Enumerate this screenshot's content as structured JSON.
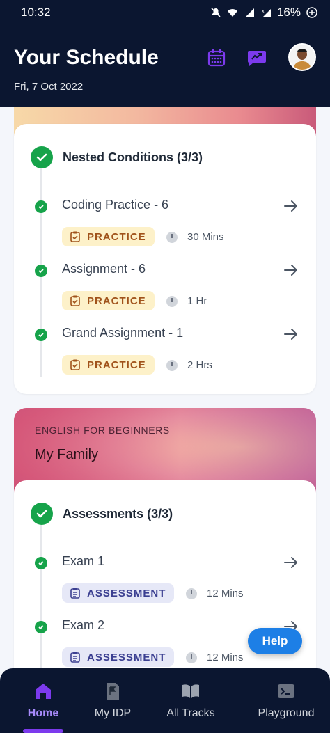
{
  "status_bar": {
    "time": "10:32",
    "battery": "16%",
    "icons": [
      "mute-icon",
      "wifi-icon",
      "signal-icon",
      "signal-x-icon",
      "battery-icon"
    ]
  },
  "header": {
    "title": "Your Schedule",
    "date": "Fri, 7 Oct 2022",
    "icons": [
      "calendar-icon",
      "chat-icon"
    ],
    "accent_color": "#7c3aed",
    "background_color": "#0b1630"
  },
  "section_1": {
    "title": "Nested Conditions (3/3)",
    "items": [
      {
        "title": "Coding Practice - 6",
        "tag": "PRACTICE",
        "duration": "30 Mins"
      },
      {
        "title": "Assignment - 6",
        "tag": "PRACTICE",
        "duration": "1 Hr"
      },
      {
        "title": "Grand Assignment - 1",
        "tag": "PRACTICE",
        "duration": "2 Hrs"
      }
    ]
  },
  "course": {
    "category": "ENGLISH FOR BEGINNERS",
    "name": "My Family"
  },
  "section_2": {
    "title": "Assessments (3/3)",
    "items": [
      {
        "title": "Exam 1",
        "tag": "ASSESSMENT",
        "duration": "12 Mins"
      },
      {
        "title": "Exam 2",
        "tag": "ASSESSMENT",
        "duration": "12 Mins"
      }
    ]
  },
  "help": {
    "label": "Help"
  },
  "bottom_nav": {
    "items": [
      {
        "label": "Home",
        "icon": "home-icon",
        "active": true
      },
      {
        "label": "My IDP",
        "icon": "document-flag-icon",
        "active": false
      },
      {
        "label": "All Tracks",
        "icon": "book-icon",
        "active": false
      },
      {
        "label": "Playground",
        "icon": "terminal-icon",
        "active": false
      }
    ]
  },
  "colors": {
    "complete_green": "#16a34a",
    "practice_tag_bg": "#fdf1c9",
    "practice_tag_text": "#a0521a",
    "assessment_tag_bg": "#e6e8f7",
    "assessment_tag_text": "#3b3f91",
    "help_button": "#1d7fe6"
  }
}
